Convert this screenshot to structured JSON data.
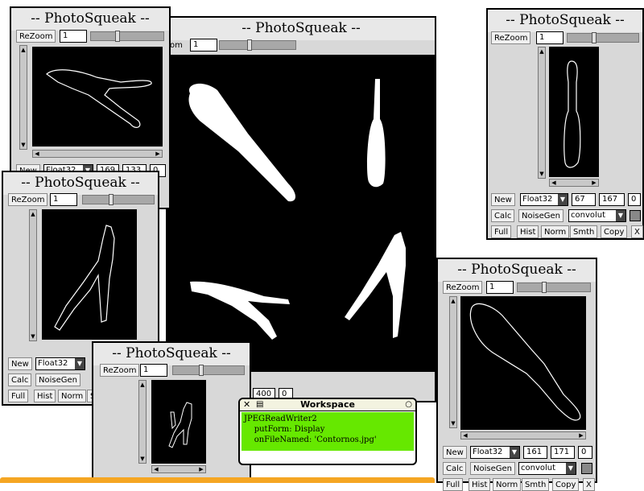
{
  "main_window": {
    "title": "-- PhotoSqueak --",
    "zoom_label_tail": "om",
    "zoom_value": "1",
    "field_a": "400",
    "field_b": "0"
  },
  "window_top_left": {
    "title": "-- PhotoSqueak --",
    "rezoom_label": "ReZoom",
    "zoom_value": "1",
    "new_label": "New",
    "format_value": "Float32",
    "width_value": "169",
    "height_value": "133",
    "extra_value": "0"
  },
  "window_middle_left": {
    "title": "-- PhotoSqueak --",
    "rezoom_label": "ReZoom",
    "zoom_value": "1",
    "new_label": "New",
    "format_value": "Float32",
    "calc_label": "Calc",
    "noisegen_label": "NoiseGen",
    "full_label": "Full",
    "hist_label": "Hist",
    "norm_label": "Norm",
    "smth_partial": "S"
  },
  "window_bottom_left": {
    "title": "-- PhotoSqueak --",
    "rezoom_label": "ReZoom",
    "zoom_value": "1"
  },
  "window_top_right": {
    "title": "-- PhotoSqueak --",
    "rezoom_label": "ReZoom",
    "zoom_value": "1",
    "new_label": "New",
    "format_value": "Float32",
    "width_value": "67",
    "height_value": "167",
    "extra_value": "0",
    "calc_label": "Calc",
    "noisegen_label": "NoiseGen",
    "op_value": "convolut",
    "full_label": "Full",
    "hist_label": "Hist",
    "norm_label": "Norm",
    "smth_label": "Smth",
    "copy_label": "Copy",
    "x_label": "X"
  },
  "window_bottom_right": {
    "title": "-- PhotoSqueak --",
    "rezoom_label": "ReZoom",
    "zoom_value": "1",
    "new_label": "New",
    "format_value": "Float32",
    "width_value": "161",
    "height_value": "171",
    "extra_value": "0",
    "calc_label": "Calc",
    "noisegen_label": "NoiseGen",
    "op_value": "convolut",
    "full_label": "Full",
    "hist_label": "Hist",
    "norm_label": "Norm",
    "smth_label": "Smth",
    "copy_label": "Copy",
    "x_label": "X"
  },
  "workspace": {
    "title": "Workspace",
    "line1": "JPEGReadWriter2",
    "line2": "    putForm: Display",
    "line3": "    onFileNamed: 'Contornos.jpg'"
  },
  "colors": {
    "workspace_highlight": "#66e800",
    "taskbar": "#f5a623"
  }
}
